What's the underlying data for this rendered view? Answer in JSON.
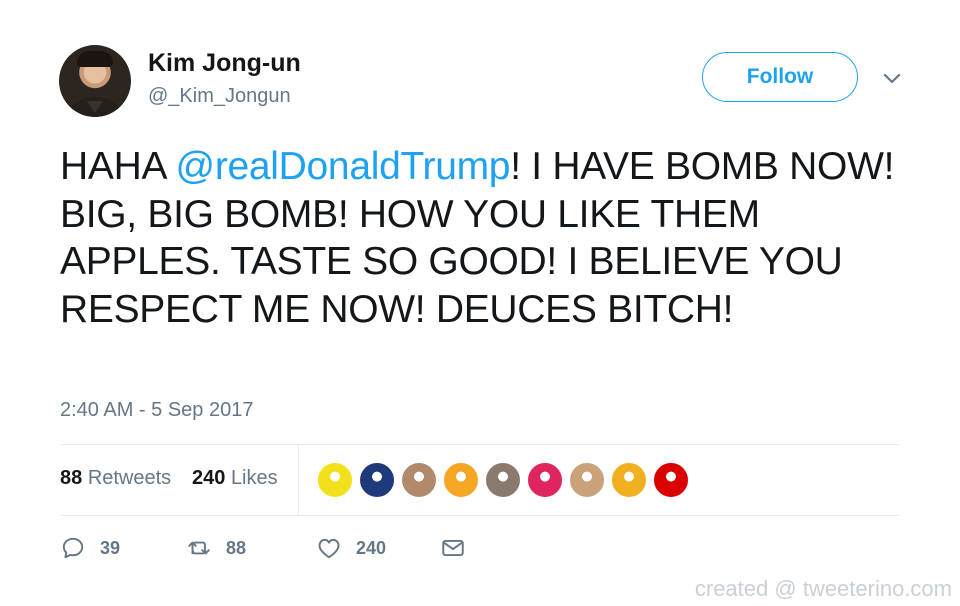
{
  "user": {
    "name": "Kim Jong-un",
    "handle": "@_Kim_Jongun"
  },
  "follow_label": "Follow",
  "tweet": {
    "text_before": "HAHA ",
    "mention": "@realDonaldTrump",
    "text_after": "! I HAVE BOMB NOW! BIG, BIG BOMB! HOW YOU LIKE THEM APPLES. TASTE SO GOOD!  I BELIEVE YOU RESPECT ME NOW! DEUCES BITCH!",
    "timestamp": "2:40 AM - 5 Sep 2017"
  },
  "stats": {
    "retweets_count": "88",
    "retweets_label": "Retweets",
    "likes_count": "240",
    "likes_label": "Likes"
  },
  "actions": {
    "replies": "39",
    "retweets": "88",
    "likes": "240"
  },
  "likers": [
    {
      "name": "liker-avatar-yellow-emblem",
      "color": "#f2e01c"
    },
    {
      "name": "liker-avatar-trump-badge",
      "color": "#1e3a7a"
    },
    {
      "name": "liker-avatar-woman-1",
      "color": "#b08a6a"
    },
    {
      "name": "liker-avatar-orange-egg",
      "color": "#f5a623"
    },
    {
      "name": "liker-avatar-man-1",
      "color": "#8a7a6e"
    },
    {
      "name": "liker-avatar-pink-egg",
      "color": "#e0245e"
    },
    {
      "name": "liker-avatar-woman-2",
      "color": "#c9a27a"
    },
    {
      "name": "liker-avatar-sunset",
      "color": "#f0b020"
    },
    {
      "name": "liker-avatar-iran-flag",
      "color": "#da0000"
    }
  ],
  "colors": {
    "accent": "#1da1f2",
    "muted": "#657786",
    "text": "#14171a",
    "divider": "#e6ecf0"
  },
  "watermark": "created @ tweeterino.com"
}
